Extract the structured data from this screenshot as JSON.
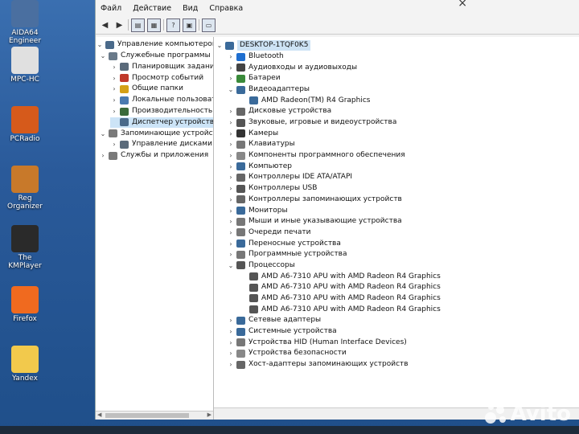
{
  "desktop": {
    "icons": [
      {
        "label": "AIDA64 Engineer",
        "color": "#4a6fa0"
      },
      {
        "label": "MPC-HC",
        "color": "#e0e0e0"
      },
      {
        "label": "PCRadio",
        "color": "#d65a1b"
      },
      {
        "label": "Reg Organizer",
        "color": "#c8792a"
      },
      {
        "label": "The KMPlayer",
        "color": "#2a2a2a"
      },
      {
        "label": "Firefox",
        "color": "#f06a1f"
      },
      {
        "label": "Yandex",
        "color": "#f2c94c"
      }
    ]
  },
  "menu": [
    "Файл",
    "Действие",
    "Вид",
    "Справка"
  ],
  "left_tree": {
    "root": "Управление компьютером (л",
    "items": [
      {
        "label": "Служебные программы",
        "level": 1,
        "expanded": true,
        "icon_color": "#6a7a8a"
      },
      {
        "label": "Планировщик заданий",
        "level": 2,
        "icon_color": "#5a6a7a"
      },
      {
        "label": "Просмотр событий",
        "level": 2,
        "icon_color": "#c0392b"
      },
      {
        "label": "Общие папки",
        "level": 2,
        "icon_color": "#d4a017"
      },
      {
        "label": "Локальные пользовате",
        "level": 2,
        "icon_color": "#4a7ab0"
      },
      {
        "label": "Производительность",
        "level": 2,
        "icon_color": "#3a6a3a"
      },
      {
        "label": "Диспетчер устройств",
        "level": 2,
        "selected": true,
        "icon_color": "#4a6a8a"
      },
      {
        "label": "Запоминающие устройств",
        "level": 1,
        "expanded": true,
        "icon_color": "#7a7a7a"
      },
      {
        "label": "Управление дисками",
        "level": 2,
        "icon_color": "#5a6a7a"
      },
      {
        "label": "Службы и приложения",
        "level": 1,
        "icon_color": "#7a7a7a"
      }
    ]
  },
  "device_tree": {
    "root": "DESKTOP-1TQF0K5",
    "items": [
      {
        "label": "Bluetooth",
        "level": 1,
        "arrow": "›",
        "icon_color": "#1f6fd0"
      },
      {
        "label": "Аудиовходы и аудиовыходы",
        "level": 1,
        "arrow": "›",
        "icon_color": "#444"
      },
      {
        "label": "Батареи",
        "level": 1,
        "arrow": "›",
        "icon_color": "#3a8a3a"
      },
      {
        "label": "Видеоадаптеры",
        "level": 1,
        "arrow": "⌄",
        "icon_color": "#3a6a9a"
      },
      {
        "label": "AMD Radeon(TM) R4 Graphics",
        "level": 2,
        "arrow": "",
        "icon_color": "#3a6a9a"
      },
      {
        "label": "Дисковые устройства",
        "level": 1,
        "arrow": "›",
        "icon_color": "#666"
      },
      {
        "label": "Звуковые, игровые и видеоустройства",
        "level": 1,
        "arrow": "›",
        "icon_color": "#555"
      },
      {
        "label": "Камеры",
        "level": 1,
        "arrow": "›",
        "icon_color": "#333"
      },
      {
        "label": "Клавиатуры",
        "level": 1,
        "arrow": "›",
        "icon_color": "#777"
      },
      {
        "label": "Компоненты программного обеспечения",
        "level": 1,
        "arrow": "›",
        "icon_color": "#888"
      },
      {
        "label": "Компьютер",
        "level": 1,
        "arrow": "›",
        "icon_color": "#3a6a9a"
      },
      {
        "label": "Контроллеры IDE ATA/ATAPI",
        "level": 1,
        "arrow": "›",
        "icon_color": "#666"
      },
      {
        "label": "Контроллеры USB",
        "level": 1,
        "arrow": "›",
        "icon_color": "#555"
      },
      {
        "label": "Контроллеры запоминающих устройств",
        "level": 1,
        "arrow": "›",
        "icon_color": "#666"
      },
      {
        "label": "Мониторы",
        "level": 1,
        "arrow": "›",
        "icon_color": "#3a6a9a"
      },
      {
        "label": "Мыши и иные указывающие устройства",
        "level": 1,
        "arrow": "›",
        "icon_color": "#777"
      },
      {
        "label": "Очереди печати",
        "level": 1,
        "arrow": "›",
        "icon_color": "#777"
      },
      {
        "label": "Переносные устройства",
        "level": 1,
        "arrow": "›",
        "icon_color": "#3a6a9a"
      },
      {
        "label": "Программные устройства",
        "level": 1,
        "arrow": "›",
        "icon_color": "#777"
      },
      {
        "label": "Процессоры",
        "level": 1,
        "arrow": "⌄",
        "icon_color": "#555"
      },
      {
        "label": "AMD A6-7310 APU with AMD Radeon R4 Graphics",
        "level": 2,
        "arrow": "",
        "icon_color": "#555"
      },
      {
        "label": "AMD A6-7310 APU with AMD Radeon R4 Graphics",
        "level": 2,
        "arrow": "",
        "icon_color": "#555"
      },
      {
        "label": "AMD A6-7310 APU with AMD Radeon R4 Graphics",
        "level": 2,
        "arrow": "",
        "icon_color": "#555"
      },
      {
        "label": "AMD A6-7310 APU with AMD Radeon R4 Graphics",
        "level": 2,
        "arrow": "",
        "icon_color": "#555"
      },
      {
        "label": "Сетевые адаптеры",
        "level": 1,
        "arrow": "›",
        "icon_color": "#3a6a9a"
      },
      {
        "label": "Системные устройства",
        "level": 1,
        "arrow": "›",
        "icon_color": "#3a6a9a"
      },
      {
        "label": "Устройства HID (Human Interface Devices)",
        "level": 1,
        "arrow": "›",
        "icon_color": "#777"
      },
      {
        "label": "Устройства безопасности",
        "level": 1,
        "arrow": "›",
        "icon_color": "#888"
      },
      {
        "label": "Хост-адаптеры запоминающих устройств",
        "level": 1,
        "arrow": "›",
        "icon_color": "#666"
      }
    ]
  },
  "watermark": "Avito"
}
